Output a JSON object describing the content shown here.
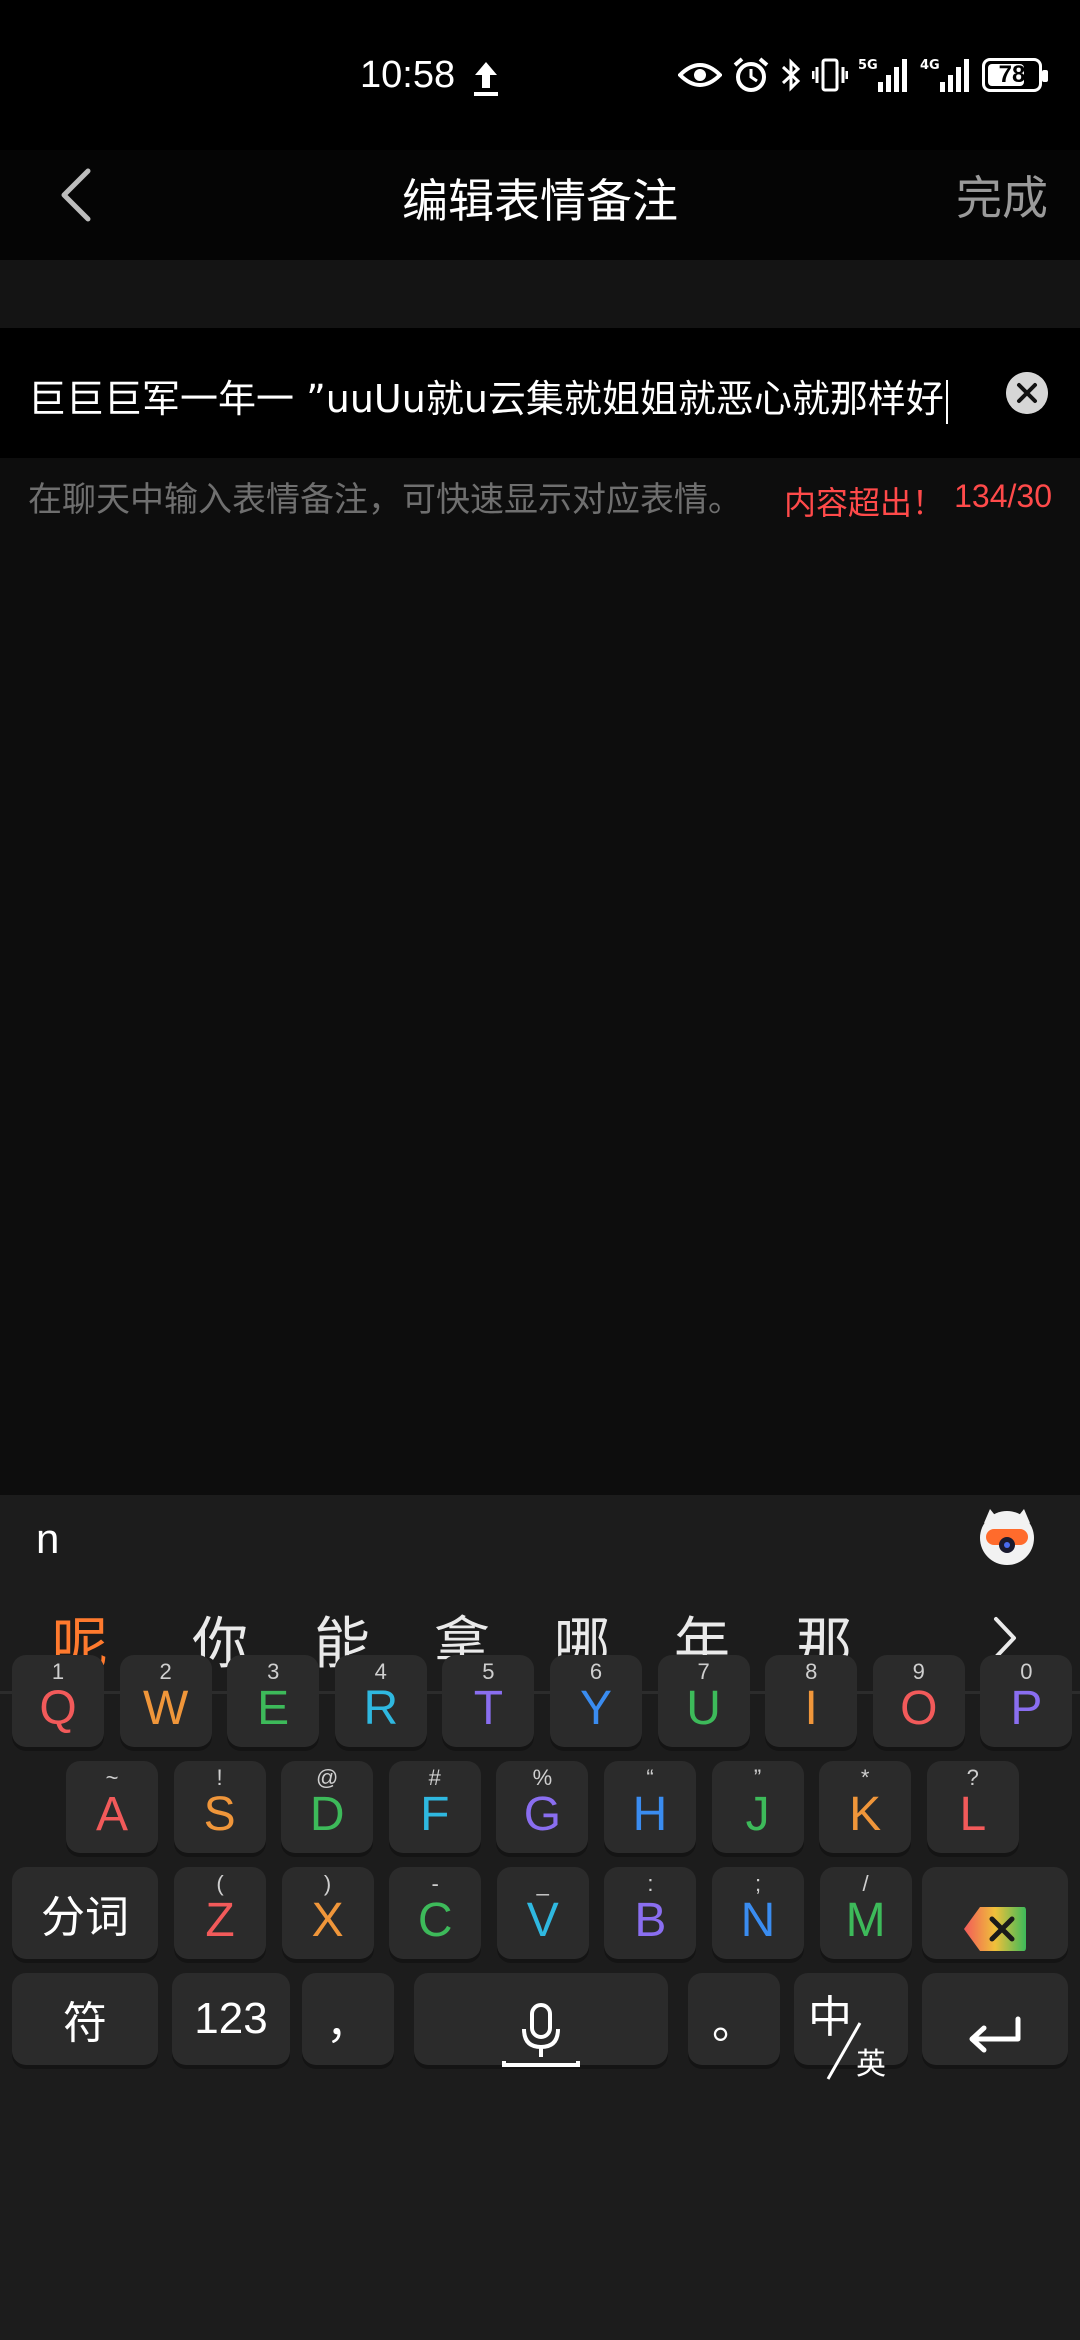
{
  "status_bar": {
    "time": "10:58",
    "battery": "78",
    "signal_5g": "5G",
    "signal_4g": "4G"
  },
  "header": {
    "title": "编辑表情备注",
    "done_label": "完成"
  },
  "input": {
    "value": "巨巨巨军一年一 ”uuUu就u云集就姐姐就恶心就那样好"
  },
  "hint": {
    "text": "在聊天中输入表情备注，可快速显示对应表情。",
    "warning": "内容超出！",
    "counter": "134/30"
  },
  "ime": {
    "composing": "n",
    "candidates": [
      "呢",
      "你",
      "能",
      "拿",
      "哪",
      "年",
      "那"
    ],
    "row1": [
      {
        "sub": "1",
        "main": "Q",
        "color": "#f25a5a"
      },
      {
        "sub": "2",
        "main": "W",
        "color": "#f0963a"
      },
      {
        "sub": "3",
        "main": "E",
        "color": "#3dba5a"
      },
      {
        "sub": "4",
        "main": "R",
        "color": "#2fb8e0"
      },
      {
        "sub": "5",
        "main": "T",
        "color": "#8a6ef0"
      },
      {
        "sub": "6",
        "main": "Y",
        "color": "#3a8cf0"
      },
      {
        "sub": "7",
        "main": "U",
        "color": "#3dba5a"
      },
      {
        "sub": "8",
        "main": "I",
        "color": "#f0963a"
      },
      {
        "sub": "9",
        "main": "O",
        "color": "#f25a5a"
      },
      {
        "sub": "0",
        "main": "P",
        "color": "#8a6ef0"
      }
    ],
    "row2": [
      {
        "sub": "~",
        "main": "A",
        "color": "#f25a5a"
      },
      {
        "sub": "!",
        "main": "S",
        "color": "#f0963a"
      },
      {
        "sub": "@",
        "main": "D",
        "color": "#3dba5a"
      },
      {
        "sub": "#",
        "main": "F",
        "color": "#2fb8e0"
      },
      {
        "sub": "%",
        "main": "G",
        "color": "#8a6ef0"
      },
      {
        "sub": "“",
        "main": "H",
        "color": "#3a8cf0"
      },
      {
        "sub": "”",
        "main": "J",
        "color": "#3dba5a"
      },
      {
        "sub": "*",
        "main": "K",
        "color": "#f0963a"
      },
      {
        "sub": "?",
        "main": "L",
        "color": "#f25a5a"
      }
    ],
    "row3": [
      {
        "sub": "(",
        "main": "Z",
        "color": "#f25a5a"
      },
      {
        "sub": ")",
        "main": "X",
        "color": "#f0963a"
      },
      {
        "sub": "-",
        "main": "C",
        "color": "#3dba5a"
      },
      {
        "sub": "_",
        "main": "V",
        "color": "#2fb8e0"
      },
      {
        "sub": ":",
        "main": "B",
        "color": "#8a6ef0"
      },
      {
        "sub": ";",
        "main": "N",
        "color": "#3a8cf0"
      },
      {
        "sub": "/",
        "main": "M",
        "color": "#3dba5a"
      }
    ],
    "segment_label": "分词",
    "symbol_label": "符",
    "numbers_label": "123",
    "comma_label": "，",
    "period_label": "。",
    "lang_main": "中",
    "lang_sub": "英"
  }
}
